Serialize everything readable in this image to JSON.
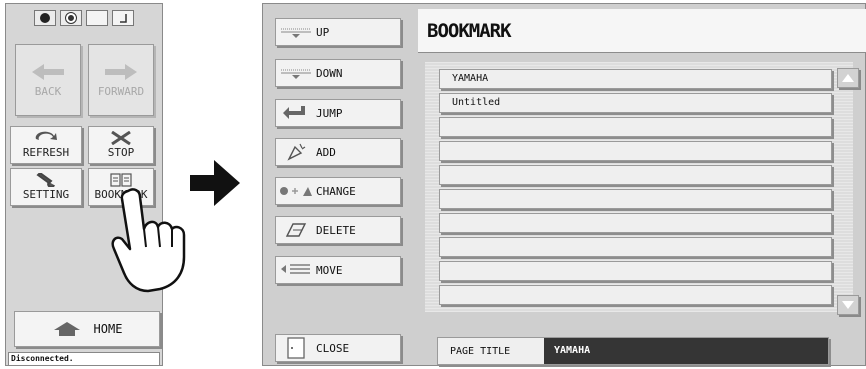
{
  "left_panel": {
    "status_icons": [
      "globe-icon",
      "connection-icon",
      "blank-icon",
      "signal-icon"
    ],
    "buttons": {
      "back": "BACK",
      "forward": "FORWARD",
      "refresh": "REFRESH",
      "stop": "STOP",
      "setting": "SETTING",
      "bookmark": "BOOKMARK"
    },
    "home": "HOME",
    "status": "Disconnected."
  },
  "right_panel": {
    "commands": [
      "UP",
      "DOWN",
      "JUMP",
      "ADD",
      "CHANGE",
      "DELETE",
      "MOVE"
    ],
    "close": "CLOSE",
    "header": "BOOKMARK",
    "bookmarks": [
      "YAMAHA",
      "Untitled",
      "",
      "",
      "",
      "",
      "",
      "",
      "",
      ""
    ],
    "page_title_label": "PAGE TITLE",
    "page_title_value": "YAMAHA"
  },
  "colors": {
    "panel_bg": "#d6d6d6",
    "button_face": "#f4f4f4",
    "title_value_bg": "#353535"
  }
}
